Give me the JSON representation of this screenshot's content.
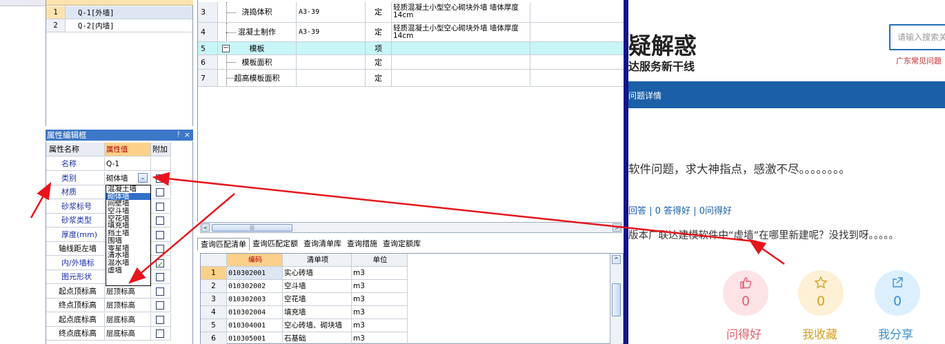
{
  "component_list": {
    "rows": [
      {
        "num": "1",
        "name": "Q-1[外墙]"
      },
      {
        "num": "2",
        "name": "Q-2[内墙]"
      }
    ]
  },
  "property_editor": {
    "title": "属性编辑框",
    "pin": "ᚹ",
    "close": "×",
    "headers": {
      "name": "属性名称",
      "value": "属性值",
      "extra": "附加"
    },
    "rows": [
      {
        "name": "名称",
        "value": "Q-1",
        "checkbox": "none"
      },
      {
        "name": "类别",
        "value": "砌体墙",
        "checkbox": "unchecked"
      },
      {
        "name": "材质",
        "value": "",
        "checkbox": "unchecked"
      },
      {
        "name": "砂浆标号",
        "value": "",
        "checkbox": "unchecked"
      },
      {
        "name": "砂浆类型",
        "value": "",
        "checkbox": "unchecked"
      },
      {
        "name": "厚度(mm)",
        "value": "",
        "checkbox": "unchecked"
      },
      {
        "name": "轴线距左墙",
        "value": "",
        "checkbox": "unchecked"
      },
      {
        "name": "内/外墙标",
        "value": "",
        "checkbox": "checked"
      },
      {
        "name": "图元形状",
        "value": "",
        "checkbox": "unchecked"
      },
      {
        "name": "起点顶标高",
        "value": "层顶标高",
        "checkbox": "unchecked"
      },
      {
        "name": "终点顶标高",
        "value": "层顶标高",
        "checkbox": "unchecked"
      },
      {
        "name": "起点底标高",
        "value": "层底标高",
        "checkbox": "unchecked"
      },
      {
        "name": "终点底标高",
        "value": "层底标高",
        "checkbox": "unchecked"
      }
    ],
    "combo_arrow": "⌄",
    "dropdown_options": [
      "混凝土墙",
      "砌体墙",
      "间壁墙",
      "空斗墙",
      "空花墙",
      "填充墙",
      "挡土墙",
      "围墙",
      "零星墙",
      "清水墙",
      "混水墙",
      "虚墙"
    ],
    "dropdown_selected": "砌体墙"
  },
  "quota_grid": {
    "rows": [
      {
        "num": "3",
        "name": "浇捣体积",
        "code": "A3-39",
        "type": "定",
        "desc": "轻质混凝土小型空心砌块外墙 墙体厚度 14cm",
        "highlight": false
      },
      {
        "num": "4",
        "name": "混凝土制作",
        "code": "A3-39",
        "type": "定",
        "desc": "轻质混凝土小型空心砌块外墙 墙体厚度 14cm",
        "highlight": false
      },
      {
        "num": "5",
        "name": "模板",
        "code": "",
        "type": "项",
        "desc": "",
        "highlight": true
      },
      {
        "num": "6",
        "name": "模板面积",
        "code": "",
        "type": "定",
        "desc": "",
        "highlight": false
      },
      {
        "num": "7",
        "name": "超高模板面积",
        "code": "",
        "type": "定",
        "desc": "",
        "highlight": false
      }
    ],
    "collapse_icon": "−"
  },
  "scrollbar": {
    "left": "<",
    "right": ">",
    "grip": "|||",
    "up": "^",
    "down": "v"
  },
  "tabs": [
    "查询匹配清单",
    "查询匹配定额",
    "查询清单库",
    "查询措施",
    "查询定额库"
  ],
  "list_grid": {
    "headers": {
      "num": "",
      "code": "编码",
      "item": "清单项",
      "unit": "单位"
    },
    "rows": [
      {
        "num": "1",
        "code": "010302001",
        "item": "实心砖墙",
        "unit": "m3"
      },
      {
        "num": "2",
        "code": "010302002",
        "item": "空斗墙",
        "unit": "m3"
      },
      {
        "num": "3",
        "code": "010302003",
        "item": "空花墙",
        "unit": "m3"
      },
      {
        "num": "4",
        "code": "010302004",
        "item": "填充墙",
        "unit": "m3"
      },
      {
        "num": "5",
        "code": "010304001",
        "item": "空心砖墙、砌块墙",
        "unit": "m3"
      },
      {
        "num": "6",
        "code": "010305001",
        "item": "石基础",
        "unit": "m3"
      }
    ]
  },
  "web": {
    "big_title": "疑解惑",
    "sub_title": "达服务新干线",
    "search_placeholder": "请输入搜索关",
    "hot_link": "广东常见问题",
    "nav_item": "问题详情",
    "question": "软件问题，求大神指点，感激不尽。。。。。。。。",
    "stats": "回答 | 0 答得好 | 0问得好",
    "answer": "版本广联达建模软件中“虚墙”在哪里新建呢？没找到呀。。。。。",
    "actions": [
      {
        "label": "问得好",
        "count": "0",
        "icon": "thumbs-up",
        "color": "#e06070",
        "bg": "#fde3e6"
      },
      {
        "label": "我收藏",
        "count": "0",
        "icon": "star",
        "color": "#d4a020",
        "bg": "#fdf0d4"
      },
      {
        "label": "我分享",
        "count": "0",
        "icon": "share",
        "color": "#3a8fd0",
        "bg": "#dcefff"
      }
    ]
  }
}
